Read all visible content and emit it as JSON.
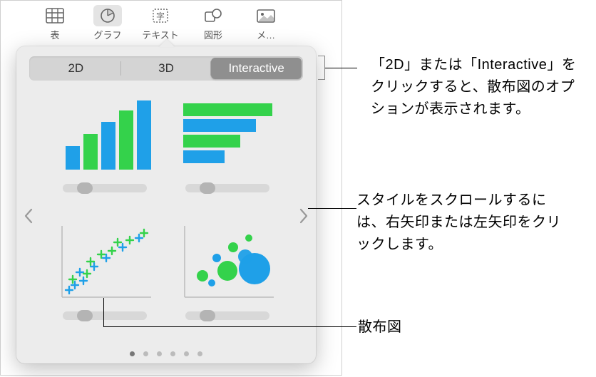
{
  "toolbar": {
    "items": [
      {
        "label": "表",
        "icon": "table-icon"
      },
      {
        "label": "グラフ",
        "icon": "chart-icon",
        "active": true
      },
      {
        "label": "テキスト",
        "icon": "text-icon"
      },
      {
        "label": "図形",
        "icon": "shape-icon"
      },
      {
        "label": "メ…",
        "icon": "media-icon"
      }
    ]
  },
  "popover": {
    "segments": [
      {
        "label": "2D"
      },
      {
        "label": "3D"
      },
      {
        "label": "Interactive",
        "active": true
      }
    ],
    "charts": [
      {
        "name": "column-chart"
      },
      {
        "name": "bar-chart"
      },
      {
        "name": "scatter-chart"
      },
      {
        "name": "bubble-chart"
      }
    ],
    "page_dots": 6,
    "active_dot": 0
  },
  "callouts": {
    "tabs": "「2D」または「Interactive」をクリックすると、散布図のオプションが表示されます。",
    "arrows": "スタイルをスクロールするには、右矢印または左矢印をクリックします。",
    "scatter": "散布図"
  }
}
